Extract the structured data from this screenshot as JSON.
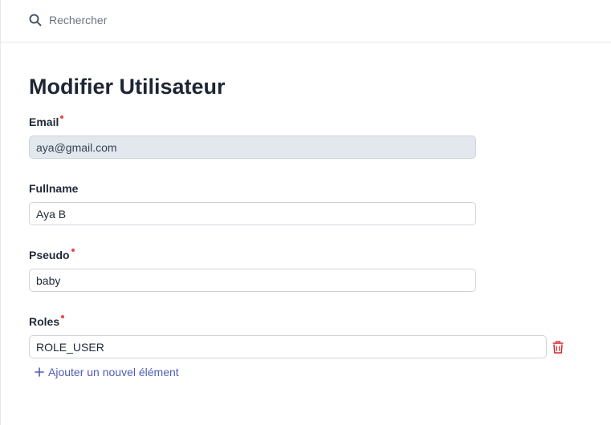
{
  "search": {
    "placeholder": "Rechercher"
  },
  "page": {
    "title": "Modifier Utilisateur"
  },
  "fields": {
    "email": {
      "label": "Email",
      "required": true,
      "value": "aya@gmail.com",
      "readonly": true
    },
    "fullname": {
      "label": "Fullname",
      "required": false,
      "value": "Aya B"
    },
    "pseudo": {
      "label": "Pseudo",
      "required": true,
      "value": "baby"
    },
    "roles": {
      "label": "Roles",
      "required": true,
      "items": [
        "ROLE_USER"
      ],
      "add_label": "Ajouter un nouvel élément"
    }
  },
  "icons": {
    "search": "search-icon",
    "delete": "trash-icon",
    "add": "plus-icon"
  },
  "colors": {
    "required": "#ef4444",
    "link": "#4f5db8",
    "delete": "#dc2626",
    "readonly_bg": "#e3e8ef"
  }
}
